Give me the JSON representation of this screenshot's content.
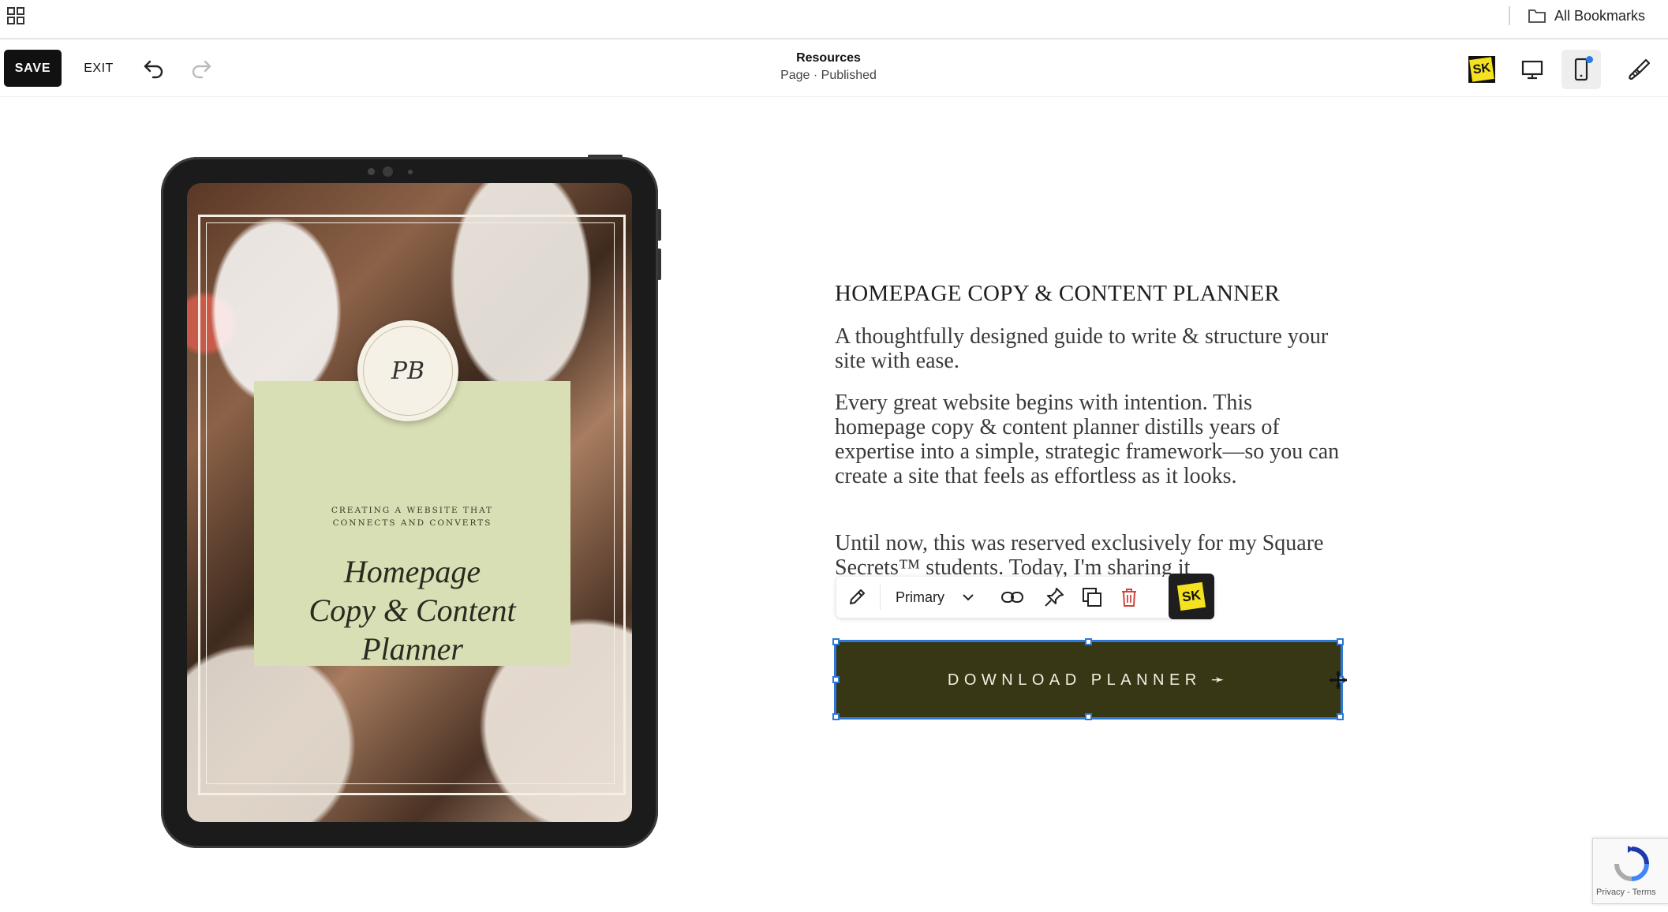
{
  "bookmarks_bar": {
    "apps_icon": "apps-grid-icon",
    "folder_icon": "folder-icon",
    "all_bookmarks_label": "All Bookmarks"
  },
  "toolbar": {
    "save_label": "SAVE",
    "exit_label": "EXIT",
    "undo_icon": "undo-icon",
    "redo_icon": "redo-icon",
    "page_title": "Resources",
    "page_status": "Page · Published",
    "sk_label": "SK",
    "desktop_icon": "desktop-view-icon",
    "mobile_icon": "mobile-view-icon",
    "brush_icon": "design-brush-icon"
  },
  "mockup": {
    "card_subtitle_line1": "CREATING A WEBSITE THAT",
    "card_subtitle_line2": "CONNECTS AND CONVERTS",
    "title_line1": "Homepage",
    "title_line2": "Copy & Content",
    "title_line3": "Planner",
    "seal_monogram": "PB"
  },
  "content": {
    "heading": "HOMEPAGE COPY & CONTENT PLANNER",
    "paragraph1": "A thoughtfully designed guide to write & structure your site with ease.",
    "paragraph2": "Every great website begins with intention. This homepage copy & content planner distills years of expertise into a simple, strategic framework—so you can create a site that feels as effortless as it looks.",
    "paragraph3": "Until now, this was reserved exclusively for my Square Secrets™ students. Today, I'm sharing it"
  },
  "edit_toolbar": {
    "style_value": "Primary",
    "icons": [
      "pencil-icon",
      "chevron-down-icon",
      "link-icon",
      "pin-icon",
      "duplicate-icon",
      "trash-icon"
    ],
    "sk_label": "SK"
  },
  "cta": {
    "label": "DOWNLOAD PLANNER ➛"
  },
  "recaptcha": {
    "footer": "Privacy - Terms"
  },
  "colors": {
    "accent_blue": "#2d77d6",
    "cta_bg": "#373716",
    "card_green": "#d9dfb4",
    "delete_red": "#d0463a",
    "sk_yellow": "#f4e11f"
  }
}
